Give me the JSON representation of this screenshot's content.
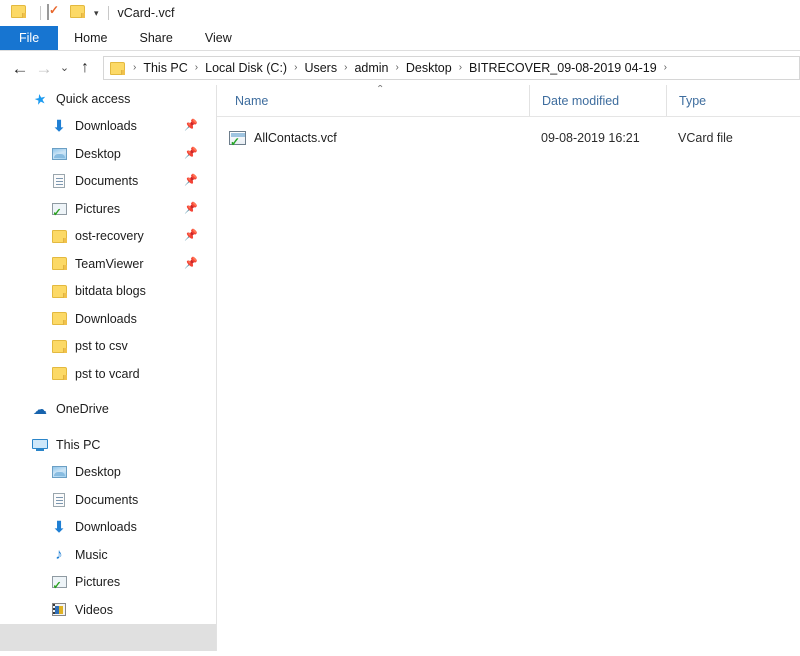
{
  "window": {
    "title": "vCard-.vcf",
    "quick_access_toolbar": [
      {
        "name": "folder-icon",
        "type": "folder"
      },
      {
        "name": "properties-icon",
        "type": "doc-check"
      },
      {
        "name": "new-folder-icon",
        "type": "folder"
      }
    ],
    "customize_dropdown": "▾"
  },
  "ribbon": {
    "tabs": [
      {
        "label": "File",
        "active": true
      },
      {
        "label": "Home",
        "active": false
      },
      {
        "label": "Share",
        "active": false
      },
      {
        "label": "View",
        "active": false
      }
    ]
  },
  "navigation": {
    "back": "←",
    "forward": "→",
    "recent_dropdown": "⌄",
    "up": "↑",
    "breadcrumb_separator": "›",
    "breadcrumbs": [
      "This PC",
      "Local Disk (C:)",
      "Users",
      "admin",
      "Desktop",
      "BITRECOVER_09-08-2019 04-19"
    ]
  },
  "sidebar": {
    "groups": [
      {
        "name": "quick-access",
        "label": "Quick access",
        "icon": "star-icon",
        "indent": 0,
        "pinned": false,
        "items": [
          {
            "label": "Downloads",
            "icon": "download-icon",
            "pinned": true
          },
          {
            "label": "Desktop",
            "icon": "desktop-icon",
            "pinned": true
          },
          {
            "label": "Documents",
            "icon": "documents-icon",
            "pinned": true
          },
          {
            "label": "Pictures",
            "icon": "pictures-icon",
            "pinned": true
          },
          {
            "label": "ost-recovery",
            "icon": "folder-icon",
            "pinned": true
          },
          {
            "label": "TeamViewer",
            "icon": "folder-icon",
            "pinned": true
          },
          {
            "label": "bitdata blogs",
            "icon": "folder-icon",
            "pinned": false
          },
          {
            "label": "Downloads",
            "icon": "folder-icon",
            "pinned": false
          },
          {
            "label": "pst to csv",
            "icon": "folder-icon",
            "pinned": false
          },
          {
            "label": "pst to vcard",
            "icon": "folder-icon",
            "pinned": false
          }
        ]
      },
      {
        "name": "onedrive",
        "label": "OneDrive",
        "icon": "cloud-icon",
        "indent": 0,
        "pinned": false,
        "items": []
      },
      {
        "name": "this-pc",
        "label": "This PC",
        "icon": "computer-icon",
        "indent": 0,
        "pinned": false,
        "items": [
          {
            "label": "Desktop",
            "icon": "desktop-icon",
            "pinned": false
          },
          {
            "label": "Documents",
            "icon": "documents-icon",
            "pinned": false
          },
          {
            "label": "Downloads",
            "icon": "download-icon",
            "pinned": false
          },
          {
            "label": "Music",
            "icon": "music-icon",
            "pinned": false
          },
          {
            "label": "Pictures",
            "icon": "pictures-icon",
            "pinned": false
          },
          {
            "label": "Videos",
            "icon": "videos-icon",
            "pinned": false
          }
        ]
      }
    ]
  },
  "file_list": {
    "columns": [
      {
        "label": "Name",
        "sorted": "asc"
      },
      {
        "label": "Date modified",
        "sorted": ""
      },
      {
        "label": "Type",
        "sorted": ""
      }
    ],
    "sort_caret": "⌃",
    "rows": [
      {
        "name": "AllContacts.vcf",
        "date_modified": "09-08-2019 16:21",
        "type": "VCard file",
        "icon": "vcard-file-icon"
      }
    ]
  },
  "colors": {
    "accent_blue": "#1775d1",
    "column_header_text": "#3e6d9e",
    "folder_yellow": "#fcd966",
    "selection_gray": "#e0e0e0"
  }
}
